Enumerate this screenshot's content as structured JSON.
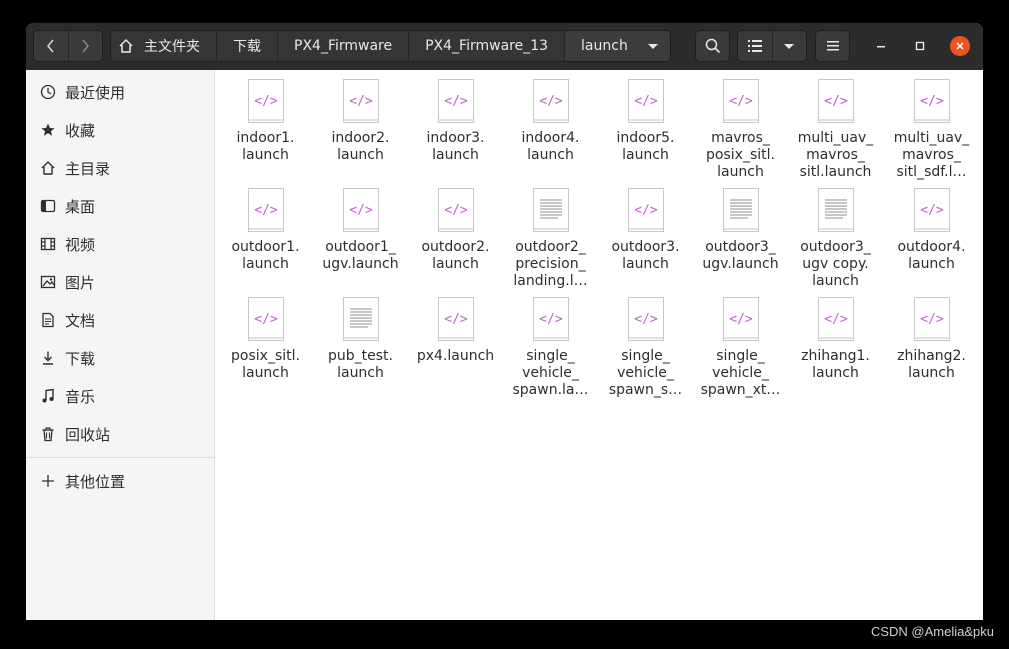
{
  "breadcrumb": {
    "home_label": "主文件夹",
    "items": [
      "下载",
      "PX4_Firmware",
      "PX4_Firmware_13"
    ],
    "current": "launch"
  },
  "sidebar": {
    "items": [
      {
        "label": "最近使用",
        "icon": "clock-icon"
      },
      {
        "label": "收藏",
        "icon": "star-icon"
      },
      {
        "label": "主目录",
        "icon": "home-icon"
      },
      {
        "label": "桌面",
        "icon": "desktop-icon"
      },
      {
        "label": "视频",
        "icon": "film-icon"
      },
      {
        "label": "图片",
        "icon": "image-icon"
      },
      {
        "label": "文档",
        "icon": "document-icon"
      },
      {
        "label": "下载",
        "icon": "download-icon"
      },
      {
        "label": "音乐",
        "icon": "music-icon"
      },
      {
        "label": "回收站",
        "icon": "trash-icon"
      }
    ],
    "other_locations": "其他位置"
  },
  "files": [
    {
      "name": "indoor1.\nlaunch",
      "kind": "code"
    },
    {
      "name": "indoor2.\nlaunch",
      "kind": "code"
    },
    {
      "name": "indoor3.\nlaunch",
      "kind": "code"
    },
    {
      "name": "indoor4.\nlaunch",
      "kind": "code"
    },
    {
      "name": "indoor5.\nlaunch",
      "kind": "code"
    },
    {
      "name": "mavros_\nposix_sitl.\nlaunch",
      "kind": "code"
    },
    {
      "name": "multi_uav_\nmavros_\nsitl.launch",
      "kind": "code"
    },
    {
      "name": "multi_uav_\nmavros_\nsitl_sdf.l…",
      "kind": "code"
    },
    {
      "name": "outdoor1.\nlaunch",
      "kind": "code"
    },
    {
      "name": "outdoor1_\nugv.launch",
      "kind": "code"
    },
    {
      "name": "outdoor2.\nlaunch",
      "kind": "code"
    },
    {
      "name": "outdoor2_\nprecision_\nlanding.l…",
      "kind": "text"
    },
    {
      "name": "outdoor3.\nlaunch",
      "kind": "code"
    },
    {
      "name": "outdoor3_\nugv.launch",
      "kind": "text"
    },
    {
      "name": "outdoor3_\nugv copy.\nlaunch",
      "kind": "text"
    },
    {
      "name": "outdoor4.\nlaunch",
      "kind": "code"
    },
    {
      "name": "posix_sitl.\nlaunch",
      "kind": "code"
    },
    {
      "name": "pub_test.\nlaunch",
      "kind": "text"
    },
    {
      "name": "px4.launch",
      "kind": "code"
    },
    {
      "name": "single_\nvehicle_\nspawn.la…",
      "kind": "code"
    },
    {
      "name": "single_\nvehicle_\nspawn_s…",
      "kind": "code"
    },
    {
      "name": "single_\nvehicle_\nspawn_xt…",
      "kind": "code"
    },
    {
      "name": "zhihang1.\nlaunch",
      "kind": "code"
    },
    {
      "name": "zhihang2.\nlaunch",
      "kind": "code"
    }
  ],
  "colors": {
    "accent": "#e95420",
    "code_tag": "#c061cb",
    "headerbar": "#2c2c2c"
  },
  "watermark": "CSDN @Amelia&pku"
}
